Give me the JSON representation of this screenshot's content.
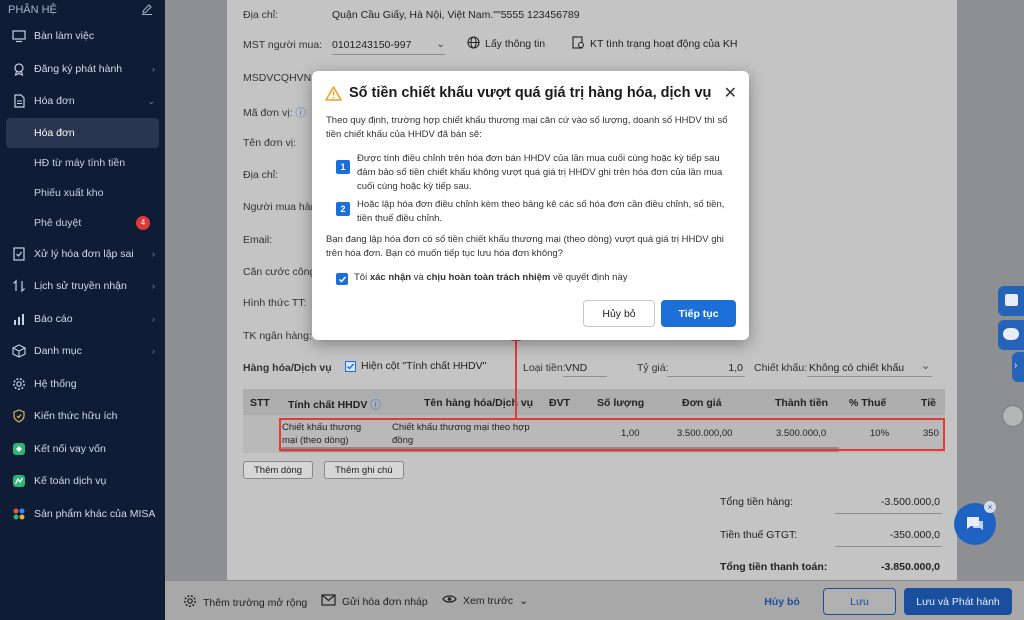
{
  "sidebar": {
    "header": "PHÂN HỆ",
    "items": [
      {
        "label": "Bàn làm việc",
        "icon": "desktop-icon"
      },
      {
        "label": "Đăng ký phát hành",
        "icon": "badge-icon"
      },
      {
        "label": "Hóa đơn",
        "icon": "document-icon"
      },
      {
        "label": "Xử lý hóa đơn lập sai",
        "icon": "check-doc-icon"
      },
      {
        "label": "Lịch sử truyền nhận",
        "icon": "transfer-icon"
      },
      {
        "label": "Báo cáo",
        "icon": "bar-chart-icon"
      },
      {
        "label": "Danh mục",
        "icon": "cube-icon"
      },
      {
        "label": "Hệ thống",
        "icon": "gear-icon"
      },
      {
        "label": "Kiến thức hữu ích",
        "icon": "lightbulb-icon"
      },
      {
        "label": "Kết nối vay vốn",
        "icon": "link-icon"
      },
      {
        "label": "Kế toán dịch vụ",
        "icon": "accounting-icon"
      },
      {
        "label": "Sản phẩm khác của MISA",
        "icon": "apps-icon"
      }
    ],
    "subitems": [
      {
        "label": "Hóa đơn"
      },
      {
        "label": "HĐ từ máy tính tiền"
      },
      {
        "label": "Phiếu xuất kho"
      },
      {
        "label": "Phê duyệt",
        "badge": "4"
      }
    ]
  },
  "form": {
    "address_label": "Địa chỉ:",
    "address_value": "Quận Cầu Giấy, Hà Nội, Việt Nam.\"\"5555 123456789",
    "tax_label": "MST người mua:",
    "tax_value": "0101243150-997",
    "get_info": "Lấy thông tin",
    "check_status": "KT tình trạng hoạt động của KH",
    "code_label": "MSDVCQHVNS",
    "unit_code_label": "Mã đơn vị:",
    "unit_name_label": "Tên đơn vị:",
    "address2_label": "Địa chỉ:",
    "buyer_label": "Người mua hàng",
    "email_label": "Email:",
    "id_label": "Căn cước công",
    "payment_label": "Hình thức TT:",
    "bank_label": "TK ngân hàng:",
    "goods_label": "Hàng hóa/Dịch vụ",
    "show_col": "Hiện cột \"Tính chất HHDV\"",
    "currency_label": "Loại tiền:",
    "currency_value": "VND",
    "rate_label": "Tỷ giá:",
    "rate_value": "1,0",
    "discount_label": "Chiết khấu:",
    "discount_value": "Không có chiết khấu"
  },
  "table": {
    "headers": [
      "STT",
      "Tính chất HHDV",
      "Tên hàng hóa/Dịch vụ",
      "ĐVT",
      "Số lượng",
      "Đơn giá",
      "Thành tiền",
      "% Thuế",
      "Tiề"
    ],
    "row": {
      "nature": "Chiết khấu thương mại (theo dòng)",
      "name": "Chiết khấu thương mại theo hợp đồng",
      "qty": "1,00",
      "price": "3.500.000,00",
      "amount": "3.500.000,0",
      "tax": "10%",
      "tax_amount": "350"
    },
    "add_row": "Thêm dòng",
    "add_note": "Thêm ghi chú"
  },
  "totals": {
    "goods_label": "Tổng tiền hàng:",
    "goods_value": "-3.500.000,0",
    "vat_label": "Tiền thuế GTGT:",
    "vat_value": "-350.000,0",
    "total_label": "Tổng tiền thanh toán:",
    "total_value": "-3.850.000,0"
  },
  "bottom": {
    "more_fields": "Thêm trường mở rộng",
    "send_draft": "Gửi hóa đơn nháp",
    "preview": "Xem trước",
    "cancel": "Hủy bỏ",
    "save": "Lưu",
    "save_issue": "Lưu và Phát hành"
  },
  "modal": {
    "title": "Số tiền chiết khấu vượt quá giá trị hàng hóa, dịch vụ",
    "intro": "Theo quy định, trường hợp chiết khấu thương mại căn cứ vào số lượng, doanh số HHDV thì số tiền chiết khấu của HHDV đã bán sẽ:",
    "item1": "Được tính điều chỉnh trên hóa đơn bán HHDV của lần mua cuối cùng hoặc kỳ tiếp sau đảm bảo số tiền chiết khấu không vượt quá giá trị HHDV ghi trên hóa đơn của lần mua cuối cùng hoặc kỳ tiếp sau.",
    "item2": "Hoặc lập hóa đơn điều chỉnh kèm theo bảng kê các số hóa đơn cần điều chỉnh, số tiền, tiền thuế điều chỉnh.",
    "question": "Bạn đang lập hóa đơn có số tiền chiết khấu thương mại (theo dòng) vượt quá giá trị HHDV ghi trên hóa đơn. Bạn có muốn tiếp tục lưu hóa đơn không?",
    "confirm_pre": "Tôi ",
    "confirm_b1": "xác nhận",
    "confirm_mid": " và ",
    "confirm_b2": "chịu hoàn toàn trách nhiệm",
    "confirm_post": " về quyết định này",
    "cancel": "Hủy bỏ",
    "continue": "Tiếp tục"
  },
  "colors": {
    "accent": "#1d6fd8",
    "sidebar": "#0f1c36",
    "danger": "#e53935"
  }
}
